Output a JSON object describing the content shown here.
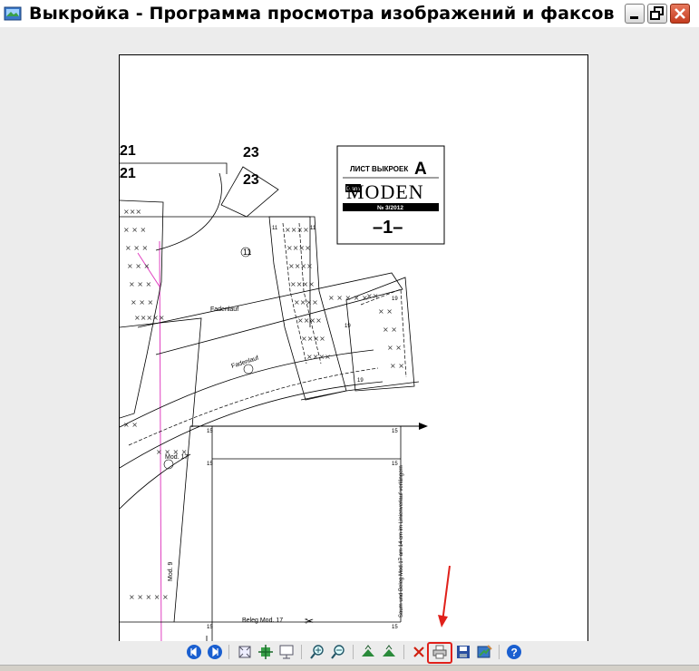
{
  "window": {
    "title": "Выкройка - Программа просмотра изображений и факсов",
    "buttons": [
      "minimize",
      "maximize",
      "close"
    ]
  },
  "document": {
    "sheet_label": "ЛИСТ ВЫКРОЕК",
    "sheet_letter": "A",
    "brand_small": "Diana",
    "brand": "MODEN",
    "issue": "№ 3/2012",
    "sheet_number": "–1–",
    "piece_numbers": [
      "21",
      "21",
      "23",
      "23"
    ],
    "markers": [
      "11",
      "19",
      "15"
    ],
    "text_labels": [
      "Fadenlauf",
      "Fadenlauf",
      "Beleg Mod. 17",
      "Mod. 17",
      "Mod. 9",
      "Saum und Beleg Mod.17 am 14 cm im Linienverlauf verlängern"
    ]
  },
  "toolbar": {
    "tools": [
      {
        "name": "previous-image",
        "icon": "arrow-left-icon"
      },
      {
        "name": "next-image",
        "icon": "arrow-right-icon"
      },
      {
        "name": "best-fit",
        "icon": "best-fit-icon"
      },
      {
        "name": "actual-size",
        "icon": "actual-size-icon"
      },
      {
        "name": "slideshow",
        "icon": "slideshow-icon"
      },
      {
        "name": "zoom-in",
        "icon": "zoom-in-icon"
      },
      {
        "name": "zoom-out",
        "icon": "zoom-out-icon"
      },
      {
        "name": "rotate-clockwise",
        "icon": "rotate-clockwise-icon"
      },
      {
        "name": "rotate-counterclockwise",
        "icon": "rotate-counterclockwise-icon"
      },
      {
        "name": "delete",
        "icon": "delete-icon"
      },
      {
        "name": "print",
        "icon": "printer-icon"
      },
      {
        "name": "save",
        "icon": "save-icon"
      },
      {
        "name": "edit",
        "icon": "edit-icon"
      },
      {
        "name": "help",
        "icon": "help-icon"
      }
    ],
    "highlighted_tool": "print"
  },
  "colors": {
    "annotation_red": "#e0201a",
    "guide_magenta": "#e040c0",
    "nav_blue": "#1a5fd0"
  }
}
